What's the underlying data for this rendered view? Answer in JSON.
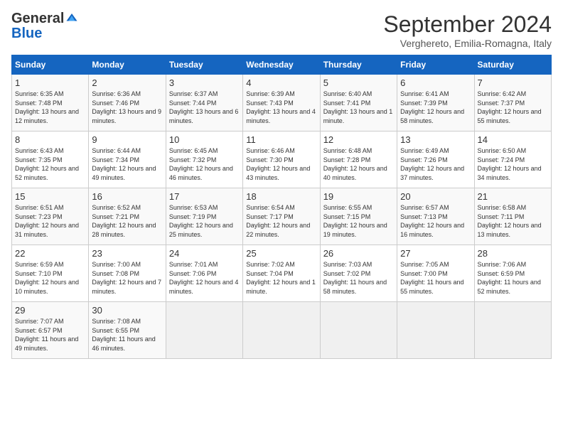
{
  "header": {
    "logo_general": "General",
    "logo_blue": "Blue",
    "month_title": "September 2024",
    "subtitle": "Verghereto, Emilia-Romagna, Italy"
  },
  "columns": [
    "Sunday",
    "Monday",
    "Tuesday",
    "Wednesday",
    "Thursday",
    "Friday",
    "Saturday"
  ],
  "weeks": [
    [
      {
        "day": "1",
        "sunrise": "6:35 AM",
        "sunset": "7:48 PM",
        "daylight": "13 hours and 12 minutes."
      },
      {
        "day": "2",
        "sunrise": "6:36 AM",
        "sunset": "7:46 PM",
        "daylight": "13 hours and 9 minutes."
      },
      {
        "day": "3",
        "sunrise": "6:37 AM",
        "sunset": "7:44 PM",
        "daylight": "13 hours and 6 minutes."
      },
      {
        "day": "4",
        "sunrise": "6:39 AM",
        "sunset": "7:43 PM",
        "daylight": "13 hours and 4 minutes."
      },
      {
        "day": "5",
        "sunrise": "6:40 AM",
        "sunset": "7:41 PM",
        "daylight": "13 hours and 1 minute."
      },
      {
        "day": "6",
        "sunrise": "6:41 AM",
        "sunset": "7:39 PM",
        "daylight": "12 hours and 58 minutes."
      },
      {
        "day": "7",
        "sunrise": "6:42 AM",
        "sunset": "7:37 PM",
        "daylight": "12 hours and 55 minutes."
      }
    ],
    [
      {
        "day": "8",
        "sunrise": "6:43 AM",
        "sunset": "7:35 PM",
        "daylight": "12 hours and 52 minutes."
      },
      {
        "day": "9",
        "sunrise": "6:44 AM",
        "sunset": "7:34 PM",
        "daylight": "12 hours and 49 minutes."
      },
      {
        "day": "10",
        "sunrise": "6:45 AM",
        "sunset": "7:32 PM",
        "daylight": "12 hours and 46 minutes."
      },
      {
        "day": "11",
        "sunrise": "6:46 AM",
        "sunset": "7:30 PM",
        "daylight": "12 hours and 43 minutes."
      },
      {
        "day": "12",
        "sunrise": "6:48 AM",
        "sunset": "7:28 PM",
        "daylight": "12 hours and 40 minutes."
      },
      {
        "day": "13",
        "sunrise": "6:49 AM",
        "sunset": "7:26 PM",
        "daylight": "12 hours and 37 minutes."
      },
      {
        "day": "14",
        "sunrise": "6:50 AM",
        "sunset": "7:24 PM",
        "daylight": "12 hours and 34 minutes."
      }
    ],
    [
      {
        "day": "15",
        "sunrise": "6:51 AM",
        "sunset": "7:23 PM",
        "daylight": "12 hours and 31 minutes."
      },
      {
        "day": "16",
        "sunrise": "6:52 AM",
        "sunset": "7:21 PM",
        "daylight": "12 hours and 28 minutes."
      },
      {
        "day": "17",
        "sunrise": "6:53 AM",
        "sunset": "7:19 PM",
        "daylight": "12 hours and 25 minutes."
      },
      {
        "day": "18",
        "sunrise": "6:54 AM",
        "sunset": "7:17 PM",
        "daylight": "12 hours and 22 minutes."
      },
      {
        "day": "19",
        "sunrise": "6:55 AM",
        "sunset": "7:15 PM",
        "daylight": "12 hours and 19 minutes."
      },
      {
        "day": "20",
        "sunrise": "6:57 AM",
        "sunset": "7:13 PM",
        "daylight": "12 hours and 16 minutes."
      },
      {
        "day": "21",
        "sunrise": "6:58 AM",
        "sunset": "7:11 PM",
        "daylight": "12 hours and 13 minutes."
      }
    ],
    [
      {
        "day": "22",
        "sunrise": "6:59 AM",
        "sunset": "7:10 PM",
        "daylight": "12 hours and 10 minutes."
      },
      {
        "day": "23",
        "sunrise": "7:00 AM",
        "sunset": "7:08 PM",
        "daylight": "12 hours and 7 minutes."
      },
      {
        "day": "24",
        "sunrise": "7:01 AM",
        "sunset": "7:06 PM",
        "daylight": "12 hours and 4 minutes."
      },
      {
        "day": "25",
        "sunrise": "7:02 AM",
        "sunset": "7:04 PM",
        "daylight": "12 hours and 1 minute."
      },
      {
        "day": "26",
        "sunrise": "7:03 AM",
        "sunset": "7:02 PM",
        "daylight": "11 hours and 58 minutes."
      },
      {
        "day": "27",
        "sunrise": "7:05 AM",
        "sunset": "7:00 PM",
        "daylight": "11 hours and 55 minutes."
      },
      {
        "day": "28",
        "sunrise": "7:06 AM",
        "sunset": "6:59 PM",
        "daylight": "11 hours and 52 minutes."
      }
    ],
    [
      {
        "day": "29",
        "sunrise": "7:07 AM",
        "sunset": "6:57 PM",
        "daylight": "11 hours and 49 minutes."
      },
      {
        "day": "30",
        "sunrise": "7:08 AM",
        "sunset": "6:55 PM",
        "daylight": "11 hours and 46 minutes."
      },
      null,
      null,
      null,
      null,
      null
    ]
  ]
}
